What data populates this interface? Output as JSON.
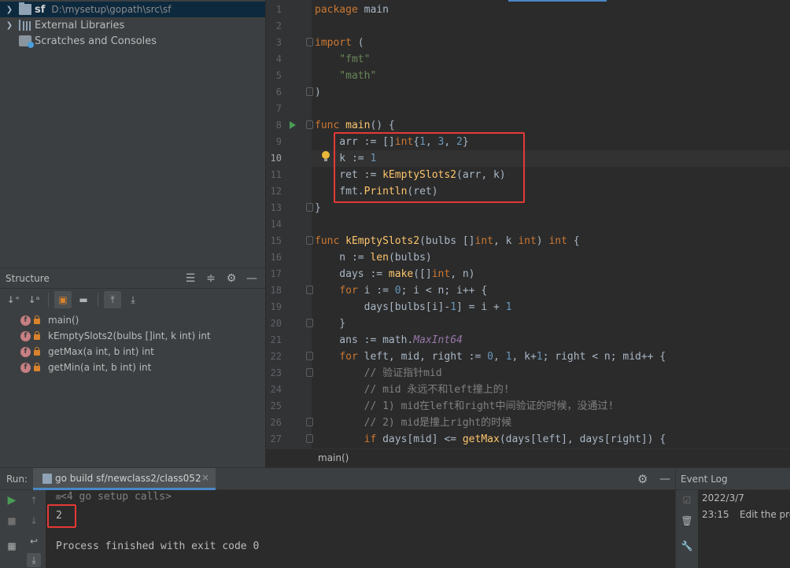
{
  "project_tree": {
    "root_name": "sf",
    "root_path": "D:\\mysetup\\gopath\\src\\sf",
    "external_libraries": "External Libraries",
    "scratches": "Scratches and Consoles"
  },
  "structure": {
    "title": "Structure",
    "items": [
      {
        "label": "main()"
      },
      {
        "label": "kEmptySlots2(bulbs []int, k int) int"
      },
      {
        "label": "getMax(a int, b int) int"
      },
      {
        "label": "getMin(a int, b int) int"
      }
    ]
  },
  "editor": {
    "line_numbers": [
      "1",
      "2",
      "3",
      "4",
      "5",
      "6",
      "7",
      "8",
      "9",
      "10",
      "11",
      "12",
      "13",
      "14",
      "15",
      "16",
      "17",
      "18",
      "19",
      "20",
      "21",
      "22",
      "23",
      "24",
      "25",
      "26",
      "27"
    ],
    "current_line": "10",
    "breadcrumb": "main()",
    "code": {
      "l1_kw": "package",
      "l1_rest": " main",
      "l3_kw": "import",
      "l3_rest": " (",
      "l4": "    \"fmt\"",
      "l5": "    \"math\"",
      "l6": ")",
      "l8_kw": "func",
      "l8_fn": " main",
      "l8_rest": "() {",
      "l9_a": "    arr := []",
      "l9_kw": "int",
      "l9_b": "{",
      "l9_n1": "1",
      "l9_c": ", ",
      "l9_n2": "3",
      "l9_d": ", ",
      "l9_n3": "2",
      "l9_e": "}",
      "l10_a": "    k := ",
      "l10_n": "1",
      "l11_a": "    ret := ",
      "l11_fn": "kEmptySlots2",
      "l11_b": "(arr, k)",
      "l12_a": "    fmt.",
      "l12_fn": "Println",
      "l12_b": "(ret)",
      "l13": "}",
      "l15_kw": "func",
      "l15_fn": " kEmptySlots2",
      "l15_a": "(bulbs []",
      "l15_kw2": "int",
      "l15_b": ", k ",
      "l15_kw3": "int",
      "l15_c": ") ",
      "l15_kw4": "int",
      "l15_d": " {",
      "l16_a": "    n := ",
      "l16_fn": "len",
      "l16_b": "(bulbs)",
      "l17_a": "    days := ",
      "l17_fn": "make",
      "l17_b": "([]",
      "l17_kw": "int",
      "l17_c": ", n)",
      "l18_a": "    ",
      "l18_kw": "for",
      "l18_b": " i := ",
      "l18_n": "0",
      "l18_c": "; i < n; i++ {",
      "l19_a": "        days[bulbs[i]-",
      "l19_n": "1",
      "l19_b": "] = i + ",
      "l19_n2": "1",
      "l20": "    }",
      "l21_a": "    ans := math.",
      "l21_it": "MaxInt64",
      "l22_a": "    ",
      "l22_kw": "for",
      "l22_b": " left, mid, right := ",
      "l22_n1": "0",
      "l22_c": ", ",
      "l22_n2": "1",
      "l22_d": ", k+",
      "l22_n3": "1",
      "l22_e": "; right < n; mid++ {",
      "l23": "        // 验证指针mid",
      "l24": "        // mid 永远不和left撞上的!",
      "l25": "        // 1) mid在left和right中间验证的时候，没通过!",
      "l26": "        // 2) mid是撞上right的时候",
      "l27_a": "        ",
      "l27_kw": "if",
      "l27_b": " days[mid] <= ",
      "l27_fn": "getMax",
      "l27_c": "(days[left], days[right]) {"
    }
  },
  "run": {
    "label": "Run:",
    "tab_label": "go build sf/newclass2/class052",
    "close": "×",
    "console": {
      "setup_calls": "<4 go setup calls>",
      "output": "2",
      "finished": "Process finished with exit code 0"
    }
  },
  "event_log": {
    "title": "Event Log",
    "date": "2022/3/7",
    "time": "23:15",
    "message": "Edit the pro"
  },
  "colors": {
    "highlight_box": "#e53935",
    "accent": "#4a88c7",
    "run_green": "#499c54"
  }
}
